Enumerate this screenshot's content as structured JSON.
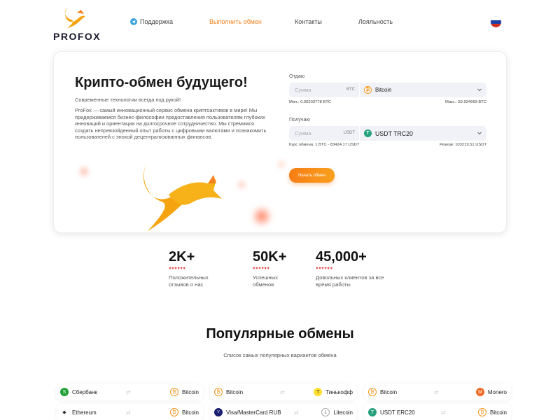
{
  "header": {
    "logo_text": "PROFOX",
    "nav": {
      "support": "Поддержка",
      "exchange": "Выполнить обмен",
      "contacts": "Контакты",
      "loyalty": "Лояльность"
    },
    "accent_color": "#f5821f"
  },
  "hero": {
    "title": "Крипто-обмен будущего!",
    "subtitle": "Современные технологии всегда под рукой!",
    "description": "ProFox — самый инновационный сервис обмена криптоактивов в мире! Мы придерживаемся бизнес-философии предоставления пользователям глубоких инноваций и ориентации на долгосрочное сотрудничество. Мы стремимся создать непревзойденный опыт работы с цифровыми валютами и познакомить пользователей с эпохой децентрализованных финансов."
  },
  "form": {
    "give_label": "Отдаю",
    "give_placeholder": "Сумма",
    "give_currency": "BTC",
    "give_asset": "Bitcoin",
    "give_min": "Мин.: 0.00203778 BTC",
    "give_max": "Макс.: 59.934669 BTC",
    "get_label": "Получаю",
    "get_placeholder": "Сумма",
    "get_currency": "USDT",
    "get_asset": "USDT TRC20",
    "rate": "Курс обмена: 1 BTC - 83424.17 USDT",
    "reserve": "Резерв: 103219.51 USDT",
    "start_button": "Начать обмен"
  },
  "stats": [
    {
      "value": "2K+",
      "hearts": "♥♥♥♥♥♥",
      "label_1": "Положительных",
      "label_2": "отзывов о нас"
    },
    {
      "value": "50K+",
      "hearts": "♥♥♥♥♥♥",
      "label_1": "Успешных",
      "label_2": "обменов"
    },
    {
      "value": "45,000+",
      "hearts": "♥♥♥♥♥♥",
      "label_1": "Довольных клиентов за все",
      "label_2": "время работы"
    }
  ],
  "popular": {
    "title": "Популярные обмены",
    "subtitle": "Список самых популярных вариантов обмена",
    "pairs": [
      {
        "from": "Сбербанк",
        "to": "Bitcoin"
      },
      {
        "from": "Bitcoin",
        "to": "Тинькофф"
      },
      {
        "from": "Bitcoin",
        "to": "Monero"
      },
      {
        "from": "Ethereum",
        "to": "Bitcoin"
      },
      {
        "from": "Visa/MasterCard RUB",
        "to": "Litecoin"
      },
      {
        "from": "USDT ERC20",
        "to": "Bitcoin"
      }
    ]
  }
}
